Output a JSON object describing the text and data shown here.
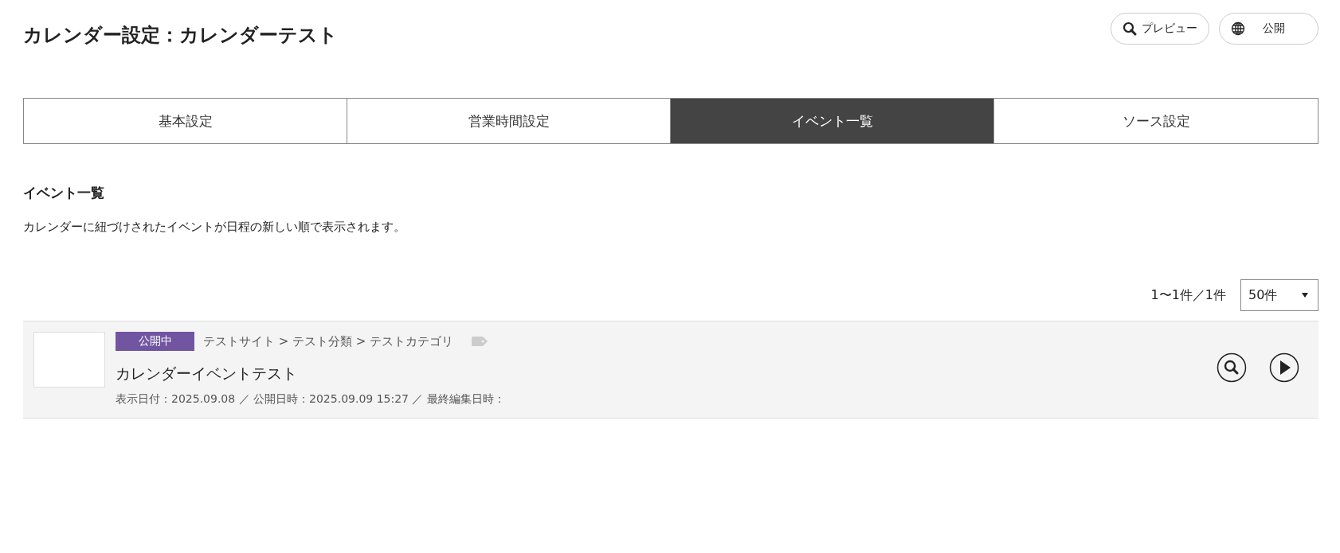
{
  "page_title": "カレンダー設定：カレンダーテスト",
  "header_buttons": [
    {
      "kind": "preview",
      "label": "プレビュー"
    },
    {
      "kind": "publish",
      "label": "公開"
    }
  ],
  "tabs": [
    {
      "label": "基本設定",
      "selected": false
    },
    {
      "label": "営業時間設定",
      "selected": false
    },
    {
      "label": "イベント一覧",
      "selected": true
    },
    {
      "label": "ソース設定",
      "selected": false
    }
  ],
  "section": {
    "title": "イベント一覧",
    "description": "カレンダーに紐づけされたイベントが日程の新しい順で表示されます。"
  },
  "pagination": {
    "count": "1〜1件／1件",
    "per_page": "50件"
  },
  "events": [
    {
      "status": "公開中",
      "color": "#7155a0",
      "breadcrumb": "テストサイト > テスト分類 > テストカテゴリ",
      "title": "カレンダーイベントテスト",
      "meta": "表示日付：2025.09.08 ／ 公開日時：2025.09.09 15:27 ／ 最終編集日時："
    }
  ]
}
